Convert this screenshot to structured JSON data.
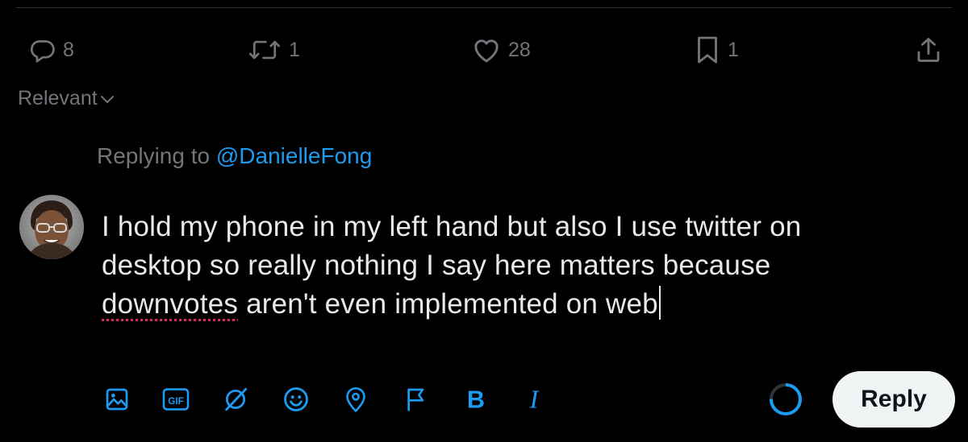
{
  "actions": {
    "replies": "8",
    "retweets": "1",
    "likes": "28",
    "bookmarks": "1"
  },
  "sort": {
    "label": "Relevant"
  },
  "reply": {
    "replying_prefix": "Replying to",
    "replying_handle": "@DanielleFong",
    "draft_line1": "I hold my phone in my left hand but also I use twitter on",
    "draft_line2": "desktop so really nothing I say here matters because",
    "draft_misspelled_word": "downvotes",
    "draft_line3_rest": " aren't even implemented on web",
    "button_label": "Reply"
  },
  "toolbar_icons": [
    "image-icon",
    "gif-icon",
    "grok-icon",
    "emoji-icon",
    "location-icon",
    "flag-icon",
    "bold-icon",
    "italic-icon"
  ],
  "colors": {
    "background": "#000000",
    "text": "#e7e9ea",
    "muted": "#71767b",
    "accent": "#1d9bf0",
    "reply_button_bg": "#eff3f4",
    "spellcheck": "#e0245e"
  }
}
